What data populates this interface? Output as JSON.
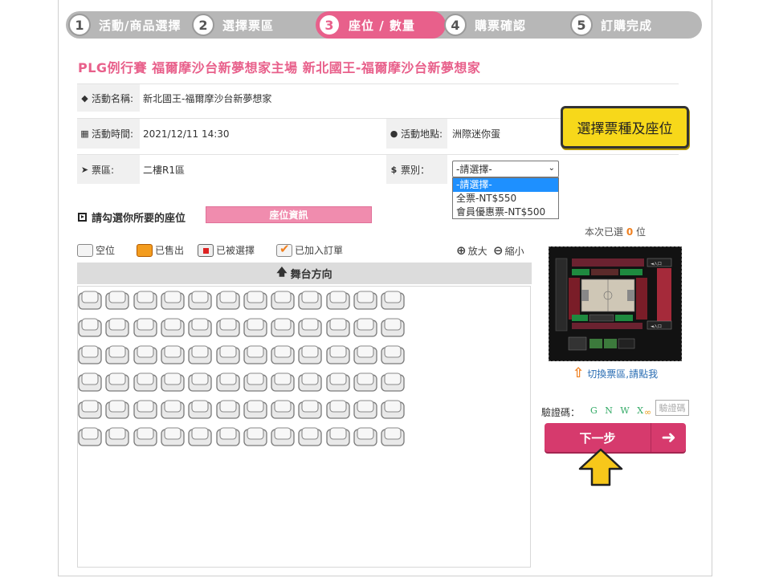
{
  "steps": [
    {
      "num": "1",
      "label": "活動/商品選擇"
    },
    {
      "num": "2",
      "label": "選擇票區"
    },
    {
      "num": "3",
      "label": "座位 / 數量"
    },
    {
      "num": "4",
      "label": "購票確認"
    },
    {
      "num": "5",
      "label": "訂購完成"
    }
  ],
  "event_title": "PLG例行賽 福爾摩沙台新夢想家主場 新北國王-福爾摩沙台新夢想家",
  "info": {
    "name_label": "活動名稱:",
    "name_value": "新北國王-福爾摩沙台新夢想家",
    "time_label": "活動時間:",
    "time_value": "2021/12/11 14:30",
    "venue_label": "活動地點:",
    "venue_value": "洲際迷你蛋",
    "zone_label": "票區:",
    "zone_value": "二樓R1區",
    "type_label": "票別：",
    "type_selected": "-請選擇-",
    "type_options": [
      "-請選擇-",
      "全票-NT$550",
      "會員優惠票-NT$500"
    ]
  },
  "callout": "選擇票種及座位",
  "seat_section": {
    "heading": "請勾選你所要的座位",
    "info_button": "座位資訊",
    "count_prefix": "本次已選",
    "count_value": "0",
    "count_suffix": "位",
    "legend": {
      "empty": "空位",
      "sold": "已售出",
      "taken": "已被選擇",
      "added": "已加入訂單"
    },
    "zoom_in": "放大",
    "zoom_out": "縮小",
    "stage_label": "舞台方向",
    "rows": 6,
    "cols": 12
  },
  "sidebar": {
    "switch_link": "切換票區,請點我",
    "captcha_label": "驗證碼：",
    "captcha_chars": "G N W X",
    "captcha_placeholder": "驗證碼",
    "next_button": "下一步"
  },
  "colors": {
    "accent": "#e8608b",
    "next_button": "#d63a6d",
    "callout": "#f7d81a",
    "step_gray": "#b7b7b7"
  }
}
